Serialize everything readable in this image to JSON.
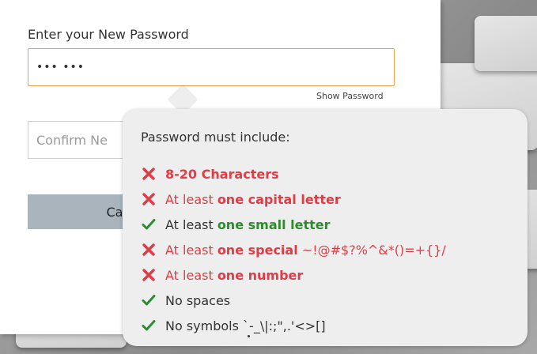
{
  "dialog": {
    "new_password_label": "Enter your New Password",
    "new_password_value": "••• •••",
    "show_password": "Show Password",
    "confirm_placeholder": "Confirm Ne",
    "cancel_label": "Can"
  },
  "tooltip": {
    "title": "Password must include:",
    "rules": [
      {
        "status": "fail",
        "prefix": "",
        "strong": "8-20 Characters",
        "suffix": ""
      },
      {
        "status": "fail",
        "prefix": "At least ",
        "strong": "one capital letter",
        "suffix": ""
      },
      {
        "status": "pass",
        "prefix": "At least ",
        "strong": "one small letter",
        "suffix": ""
      },
      {
        "status": "fail",
        "prefix": "At least ",
        "strong": "one special",
        "suffix": " ~!@#$?%^&*()=+{}/"
      },
      {
        "status": "fail",
        "prefix": "At least ",
        "strong": "one number",
        "suffix": ""
      },
      {
        "status": "pass",
        "prefix": "No spaces",
        "strong": "",
        "suffix": ""
      },
      {
        "status": "pass",
        "prefix": "No symbols `-_\\|:;\",.'<>[]",
        "strong": "",
        "suffix": ""
      }
    ]
  },
  "colors": {
    "fail": "#e13c45",
    "pass": "#2e8b2e",
    "focus_border": "#f0a24a",
    "button": "#a9b4bd"
  },
  "icons": {
    "fail": "cross-icon",
    "pass": "check-icon"
  }
}
